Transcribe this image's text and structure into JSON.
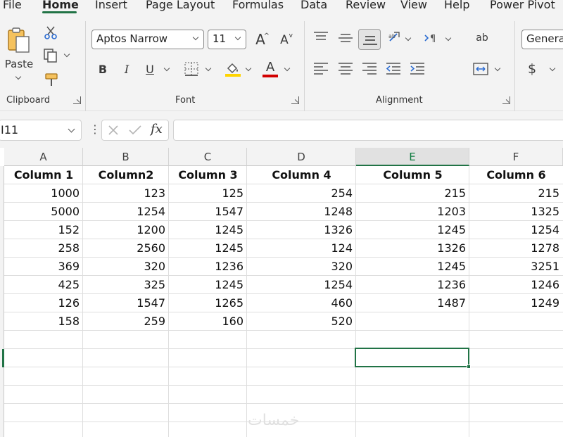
{
  "tabs": [
    "File",
    "Home",
    "Insert",
    "Page Layout",
    "Formulas",
    "Data",
    "Review",
    "View",
    "Help",
    "Power Pivot"
  ],
  "ribbon": {
    "clipboard": {
      "paste_label": "Paste",
      "group_label": "Clipboard"
    },
    "font": {
      "font_name": "Aptos Narrow",
      "font_size": "11",
      "group_label": "Font",
      "bold": "B",
      "italic": "I",
      "underline": "U",
      "font_color_glyph": "A",
      "grow_glyph": "A",
      "shrink_glyph": "A"
    },
    "alignment": {
      "group_label": "Alignment",
      "wrap_glyph": "ab"
    },
    "number": {
      "format": "General",
      "currency_glyph": "$"
    }
  },
  "formula_bar": {
    "name_box": "I11",
    "fx": "fx",
    "content": ""
  },
  "columns": [
    "A",
    "B",
    "C",
    "D",
    "E",
    "F"
  ],
  "headers": [
    "Column 1",
    "Column2",
    "Column 3",
    "Column 4",
    "Column 5",
    "Column 6"
  ],
  "rows": [
    [
      "1000",
      "123",
      "125",
      "254",
      "215",
      "215"
    ],
    [
      "5000",
      "1254",
      "1547",
      "1248",
      "1203",
      "1325"
    ],
    [
      "152",
      "1200",
      "1245",
      "1326",
      "1245",
      "1254"
    ],
    [
      "258",
      "2560",
      "1245",
      "124",
      "1326",
      "1278"
    ],
    [
      "369",
      "320",
      "1236",
      "320",
      "1245",
      "3251"
    ],
    [
      "425",
      "325",
      "1245",
      "1254",
      "1236",
      "1246"
    ],
    [
      "126",
      "1547",
      "1265",
      "460",
      "1487",
      "1249"
    ],
    [
      "158",
      "259",
      "160",
      "520",
      "",
      ""
    ]
  ],
  "selected_column": "E",
  "watermark": "خمسات",
  "colors": {
    "accent": "#217346",
    "fill_bar": "#ffd400",
    "font_color_bar": "#d20000"
  }
}
